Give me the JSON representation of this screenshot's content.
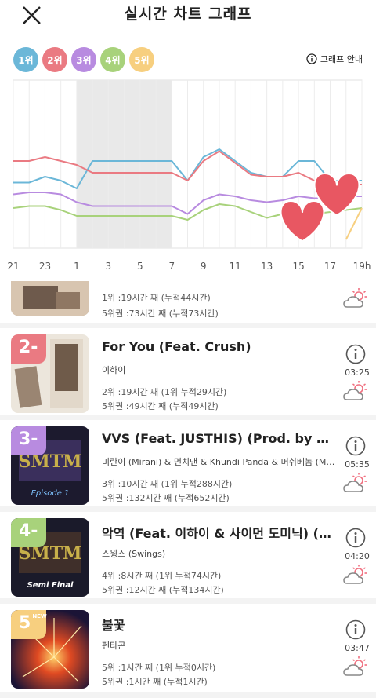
{
  "header": {
    "title": "실시간 차트 그래프"
  },
  "legend": [
    {
      "label": "1위",
      "color": "#6bb7d8"
    },
    {
      "label": "2위",
      "color": "#ea7a82"
    },
    {
      "label": "3위",
      "color": "#b88be0"
    },
    {
      "label": "4위",
      "color": "#a8d27b"
    },
    {
      "label": "5위",
      "color": "#f7cf7f"
    }
  ],
  "guide_label": "그래프 안내",
  "chart_data": {
    "type": "line",
    "x": [
      "21",
      "22",
      "23",
      "0",
      "1",
      "2",
      "3",
      "4",
      "5",
      "6",
      "7",
      "8",
      "9",
      "10",
      "11",
      "12",
      "13",
      "14",
      "15",
      "16",
      "17",
      "18",
      "19h"
    ],
    "x_tick_labels": [
      "21",
      "23",
      "1",
      "3",
      "5",
      "7",
      "9",
      "11",
      "13",
      "15",
      "17",
      "19h"
    ],
    "y_axis": "chart rank (1 at top)",
    "highlight_range": [
      "1",
      "7"
    ],
    "series": [
      {
        "color": "#6bb7d8",
        "values": [
          2.7,
          2.7,
          2.4,
          2.6,
          3.0,
          1.6,
          1.6,
          1.6,
          1.6,
          1.6,
          1.6,
          2.6,
          1.4,
          1.0,
          1.6,
          2.2,
          2.4,
          2.4,
          1.6,
          1.6,
          2.6,
          2.6,
          2.6
        ]
      },
      {
        "color": "#ea7a82",
        "values": [
          1.6,
          1.6,
          1.4,
          1.6,
          1.8,
          2.2,
          2.2,
          2.2,
          2.2,
          2.2,
          2.2,
          2.6,
          1.6,
          1.1,
          1.7,
          2.3,
          2.4,
          2.4,
          2.2,
          2.6,
          2.8,
          2.8,
          2.8
        ]
      },
      {
        "color": "#a8d27b",
        "values": [
          4.0,
          3.9,
          3.9,
          4.1,
          4.4,
          4.4,
          4.4,
          4.4,
          4.4,
          4.4,
          4.4,
          4.6,
          4.1,
          3.8,
          3.9,
          4.2,
          4.5,
          4.3,
          4.2,
          4.3,
          4.2,
          4.1,
          4.0
        ]
      },
      {
        "color": "#b88be0",
        "values": [
          3.3,
          3.2,
          3.2,
          3.3,
          3.7,
          3.9,
          3.9,
          3.9,
          3.9,
          3.9,
          3.9,
          4.3,
          3.6,
          3.3,
          3.4,
          3.6,
          3.7,
          3.6,
          3.4,
          3.5,
          3.5,
          3.4,
          3.4
        ]
      },
      {
        "color": "#f7cf7f",
        "values": [
          null,
          null,
          null,
          null,
          null,
          null,
          null,
          null,
          null,
          null,
          null,
          null,
          null,
          null,
          null,
          null,
          null,
          null,
          null,
          null,
          null,
          5.6,
          4.0
        ]
      }
    ]
  },
  "songs": [
    {
      "rank": null,
      "title": "",
      "artist": "",
      "duration": "",
      "stat1": "1위 :19시간 째 (누적44시간)",
      "stat2": "5위권 :73시간 째 (누적73시간)"
    },
    {
      "rank": "2-",
      "rank_color": "#ea7a82",
      "title": "For You (Feat. Crush)",
      "artist": "이하이",
      "duration": "03:25",
      "stat1": "2위 :19시간 째 (1위 누적29시간)",
      "stat2": "5위권 :49시간 째 (누적49시간)"
    },
    {
      "rank": "3-",
      "rank_color": "#b88be0",
      "title": "VVS (Feat. JUSTHIS) (Prod. by GroovyRoom)",
      "artist": "미란이 (Mirani) & 먼치맨 & Khundi Panda & 머쉬베놈 (MUSHVENOM)",
      "duration": "05:35",
      "stat1": "3위 :10시간 째 (1위 누적288시간)",
      "stat2": "5위권 :132시간 째 (누적652시간)"
    },
    {
      "rank": "4-",
      "rank_color": "#a8d27b",
      "title": "악역 (Feat. 이하이 & 사이먼 도미닉) (Prod. by 코드 쿤스트)",
      "artist": "스윙스 (Swings)",
      "duration": "04:20",
      "stat1": "4위 :8시간 째 (1위 누적74시간)",
      "stat2": "5위권 :12시간 째 (누적134시간)"
    },
    {
      "rank": "5",
      "rank_color": "#f7cf7f",
      "rank_sub": "NEW",
      "title": "불꽃",
      "artist": "펜타곤",
      "duration": "03:47",
      "stat1": "5위 :1시간 째 (1위 누적0시간)",
      "stat2": "5위권 :1시간 째 (누적1시간)"
    }
  ],
  "album_art": [
    {
      "caption": "",
      "colors": [
        "#b9a38f",
        "#6e5a4c"
      ]
    },
    {
      "caption": "",
      "colors": [
        "#e8e2d8",
        "#7b6555"
      ]
    },
    {
      "caption": "Episode 1",
      "colors": [
        "#1c1a2e",
        "#3a2f5c"
      ]
    },
    {
      "caption": "Semi Final",
      "colors": [
        "#1a1a2a",
        "#3f2f2a"
      ]
    },
    {
      "caption": "",
      "colors": [
        "#1b1436",
        "#e04a22"
      ]
    }
  ]
}
